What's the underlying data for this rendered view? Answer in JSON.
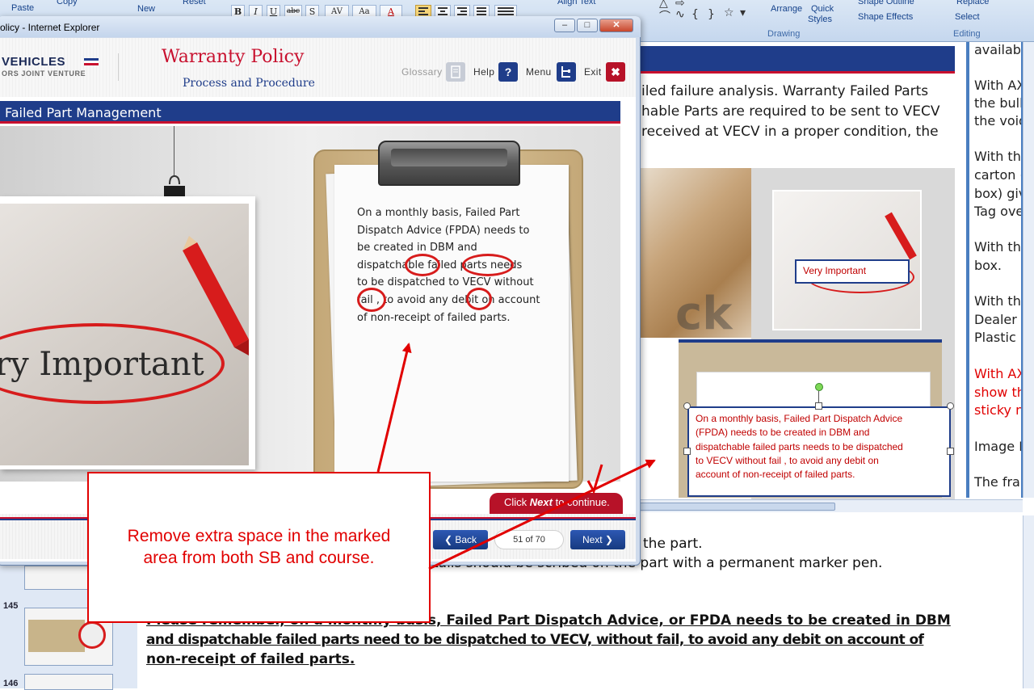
{
  "ribbon": {
    "paste_label": "Paste",
    "copy_label": "Copy",
    "new_label": "New",
    "reset_label": "Reset",
    "align_text_label": "Align Text",
    "arrange_label": "Arrange",
    "quick_styles_label": "Quick",
    "quick_styles_label_2": "Styles",
    "shape_outline_label": "Shape Outline",
    "shape_effects_label": "Shape Effects",
    "replace_label": "Replace",
    "select_label": "Select",
    "drawing_group": "Drawing",
    "editing_group": "Editing",
    "format_buttons": [
      "B",
      "I",
      "U",
      "abc",
      "S",
      "AV",
      "Aa",
      "A"
    ]
  },
  "ie_window": {
    "title": "olicy - Internet Explorer",
    "minimize": "–",
    "restore": "□",
    "close": "✕"
  },
  "course": {
    "brand": "VEHICLES",
    "brand_sub": "ORS JOINT VENTURE",
    "title": "Warranty Policy",
    "subtitle": "Process and Procedure",
    "nav": {
      "glossary": "Glossary",
      "help": "Help",
      "help_icon": "?",
      "menu": "Menu",
      "exit": "Exit",
      "exit_icon": "✖"
    },
    "section_title": "Failed Part Management",
    "photo_text": "ry Important",
    "note_lines": [
      "On a monthly basis, Failed Part",
      "Dispatch Advice (FPDA) needs to",
      "be created in DBM and",
      "dispatchable  failed parts  needs",
      "to be dispatched to VECV without",
      "fail , to avoid any debit  on account",
      "of non-receipt of failed parts."
    ],
    "continue_prefix": "Click ",
    "continue_bold": "Next",
    "continue_suffix": " to continue.",
    "back_label": "❮ Back",
    "page_count": "51 of 70",
    "next_label": "Next ❯"
  },
  "slide": {
    "body_lines": [
      "iled failure analysis. Warranty Failed Parts",
      "hable Parts are required to be sent to VECV",
      "received at VECV in a proper condition, the"
    ],
    "watermark": "ck",
    "sticky_label": "Very Important",
    "textbox_lines": [
      "On a monthly basis, Failed Part Dispatch Advice",
      "(FPDA) needs to be created in DBM and",
      "dispatchable  failed parts  needs  to be dispatched",
      "to VECV without fail , to avoid any debit  on",
      "account of non-receipt of failed parts."
    ]
  },
  "right_doc": {
    "lines": [
      {
        "text": "availab",
        "red": false
      },
      {
        "text": "With AX",
        "red": false
      },
      {
        "text": "the bull",
        "red": false
      },
      {
        "text": "the void",
        "red": false
      },
      {
        "text": "With the",
        "red": false
      },
      {
        "text": "carton (",
        "red": false
      },
      {
        "text": "box) giv",
        "red": false
      },
      {
        "text": "Tag ove",
        "red": false
      },
      {
        "text": "With the",
        "red": false
      },
      {
        "text": "box.",
        "red": false
      },
      {
        "text": "With the",
        "red": false
      },
      {
        "text": "Dealer N",
        "red": false
      },
      {
        "text": "Plastic b",
        "red": false
      },
      {
        "text": "With AX",
        "red": true
      },
      {
        "text": "show th",
        "red": true
      },
      {
        "text": "sticky n",
        "red": true
      },
      {
        "text": "Image II",
        "red": false
      },
      {
        "text": "The fran",
        "red": false
      }
    ]
  },
  "notes": {
    "line1": "the part.",
    "line2": "tails should be scribed on the part with a permanent marker pen.",
    "para": [
      "Please remember, on a monthly basis, Failed Part Dispatch Advice, or FPDA needs to be created in DBM",
      "and dispatchable failed parts  need to be dispatched to VECV, without fail, to avoid any debit on account of",
      "non-receipt of failed parts."
    ]
  },
  "slide_panel": {
    "numbers": [
      "145",
      "146"
    ]
  },
  "callout": {
    "line1": "Remove extra space in the marked",
    "line2": "area from both SB and course."
  },
  "colors": {
    "annotation_red": "#e10000",
    "course_navy": "#1f3d8a",
    "course_red": "#c8102e"
  }
}
